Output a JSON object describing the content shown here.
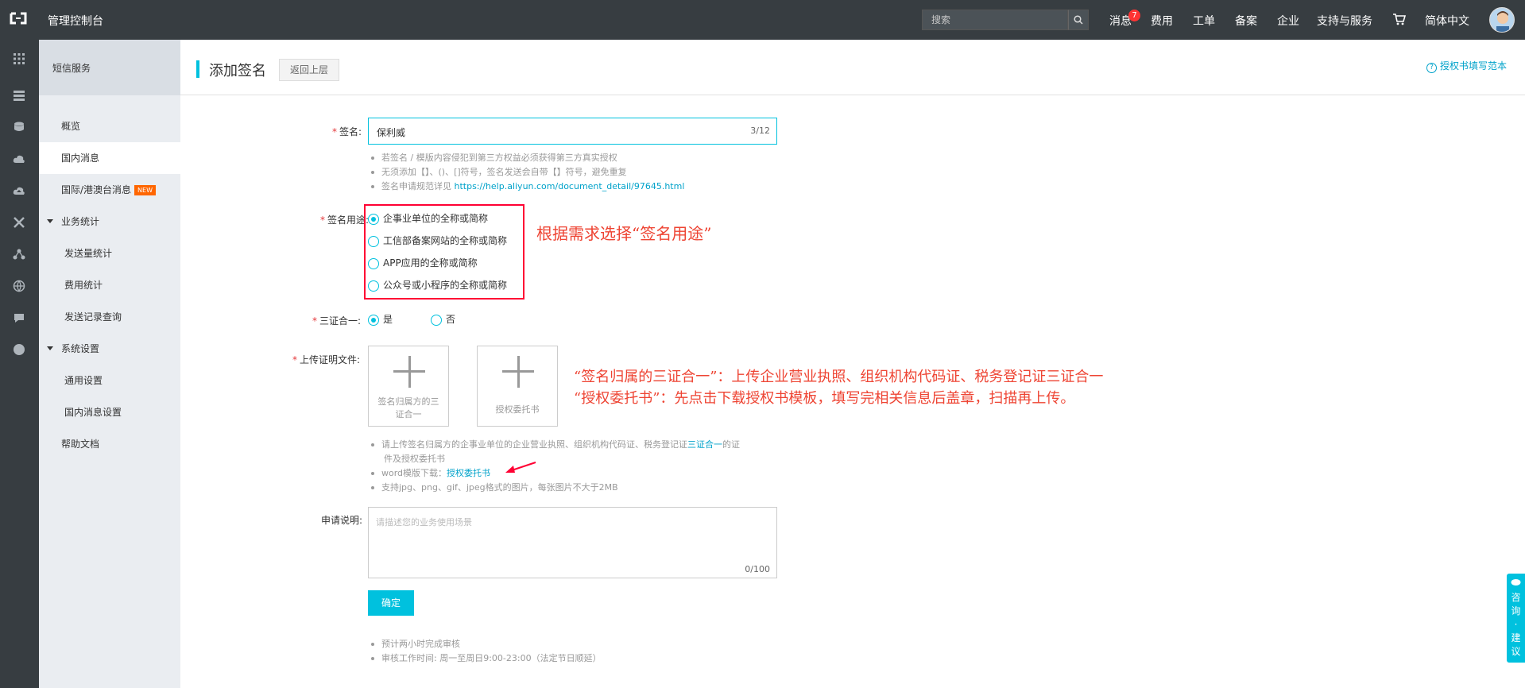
{
  "topbar": {
    "title": "管理控制台",
    "search_placeholder": "搜索",
    "nav": [
      "消息",
      "费用",
      "工单",
      "备案",
      "企业",
      "支持与服务",
      "简体中文"
    ],
    "message_badge": "7",
    "accent": "#00c1de"
  },
  "sidemenu": {
    "title": "短信服务",
    "items": [
      {
        "label": "概览"
      },
      {
        "label": "国内消息"
      },
      {
        "label": "国际/港澳台消息",
        "badge": "NEW"
      },
      {
        "label": "业务统计"
      },
      {
        "label": "发送量统计"
      },
      {
        "label": "费用统计"
      },
      {
        "label": "发送记录查询"
      },
      {
        "label": "系统设置"
      },
      {
        "label": "通用设置"
      },
      {
        "label": "国内消息设置"
      },
      {
        "label": "帮助文档"
      }
    ]
  },
  "header": {
    "title": "添加签名",
    "back": "返回上层",
    "help": "授权书填写范本",
    "help_icon": "?"
  },
  "form": {
    "required_mark": "*",
    "signature": {
      "label": "签名:",
      "value": "保利威",
      "count": "3/12",
      "hints": [
        "若签名 / 模版内容侵犯到第三方权益必须获得第三方真实授权",
        "无须添加【】、()、[]符号，签名发送会自带【】符号，避免重复",
        "签名申请规范详见 "
      ],
      "link": "https://help.aliyun.com/document_detail/97645.html"
    },
    "usage": {
      "label": "签名用途:",
      "options": [
        "企事业单位的全称或简称",
        "工信部备案网站的全称或简称",
        "APP应用的全称或简称",
        "公众号或小程序的全称或简称"
      ],
      "selected": 0
    },
    "three_in_one": {
      "label": "三证合一:",
      "yes": "是",
      "no": "否",
      "selected": "yes"
    },
    "upload": {
      "label": "上传证明文件:",
      "box1": "签名归属方的三证合一",
      "box2": "授权委托书",
      "hint1a": "请上传签名归属方的企事业单位的企业营业执照、组织机构代码证、税务登记证",
      "hint1link": "三证合一",
      "hint1b": "的证",
      "hint1c": "件及授权委托书",
      "hint2": "word模版下载：",
      "hint2link": "授权委托书",
      "hint3": "支持jpg、png、gif、jpeg格式的图片，每张图片不大于2MB"
    },
    "description": {
      "label": "申请说明:",
      "placeholder": "请描述您的业务使用场景",
      "count": "0/100"
    },
    "submit": "确定",
    "notes": [
      "预计两小时完成审核",
      "审核工作时间: 周一至周日9:00-23:00（法定节日顺延）"
    ]
  },
  "annotations": {
    "usage_note": "根据需求选择“签名用途”",
    "upload_note1": "“签名归属的三证合一”：上传企业营业执照、组织机构代码证、税务登记证三证合一",
    "upload_note2": "“授权委托书”：先点击下载授权书模板，填写完相关信息后盖章，扫描再上传。"
  },
  "float_tab": "咨询·建议"
}
